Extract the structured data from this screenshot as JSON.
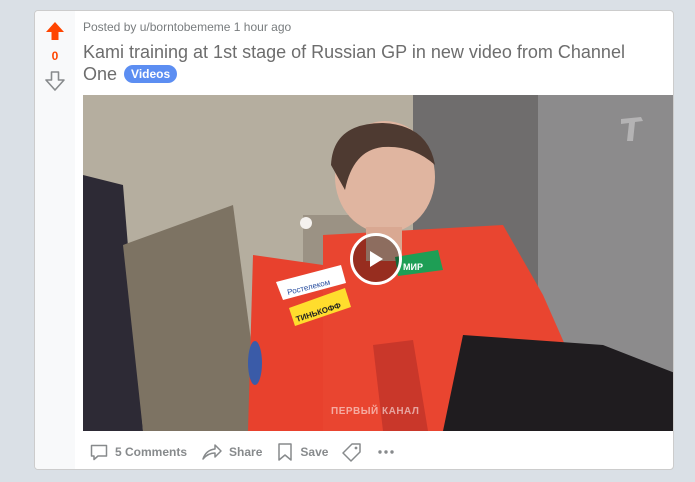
{
  "post": {
    "score": "0",
    "meta_prefix": "Posted by",
    "username": "u/borntobememe",
    "time_ago": "1 hour ago",
    "title": "Kami training at 1st stage of Russian GP in new video from Channel One",
    "flair": "Videos",
    "video": {
      "watermark": "ПЕРВЫЙ КАНАЛ",
      "jacket_text_1": "Ростелеком",
      "jacket_text_2": "ТИНЬКОФФ",
      "jacket_text_3": "МИР"
    }
  },
  "actions": {
    "comments_label": "5 Comments",
    "share_label": "Share",
    "save_label": "Save"
  },
  "colors": {
    "upvote": "#ff4500",
    "flair": "#5c8ef2",
    "action_text": "#878a8c"
  },
  "icons": [
    "upvote-arrow-icon",
    "downvote-arrow-icon",
    "play-icon",
    "comment-icon",
    "share-icon",
    "save-icon",
    "tag-icon",
    "more-icon",
    "channel-one-logo"
  ]
}
